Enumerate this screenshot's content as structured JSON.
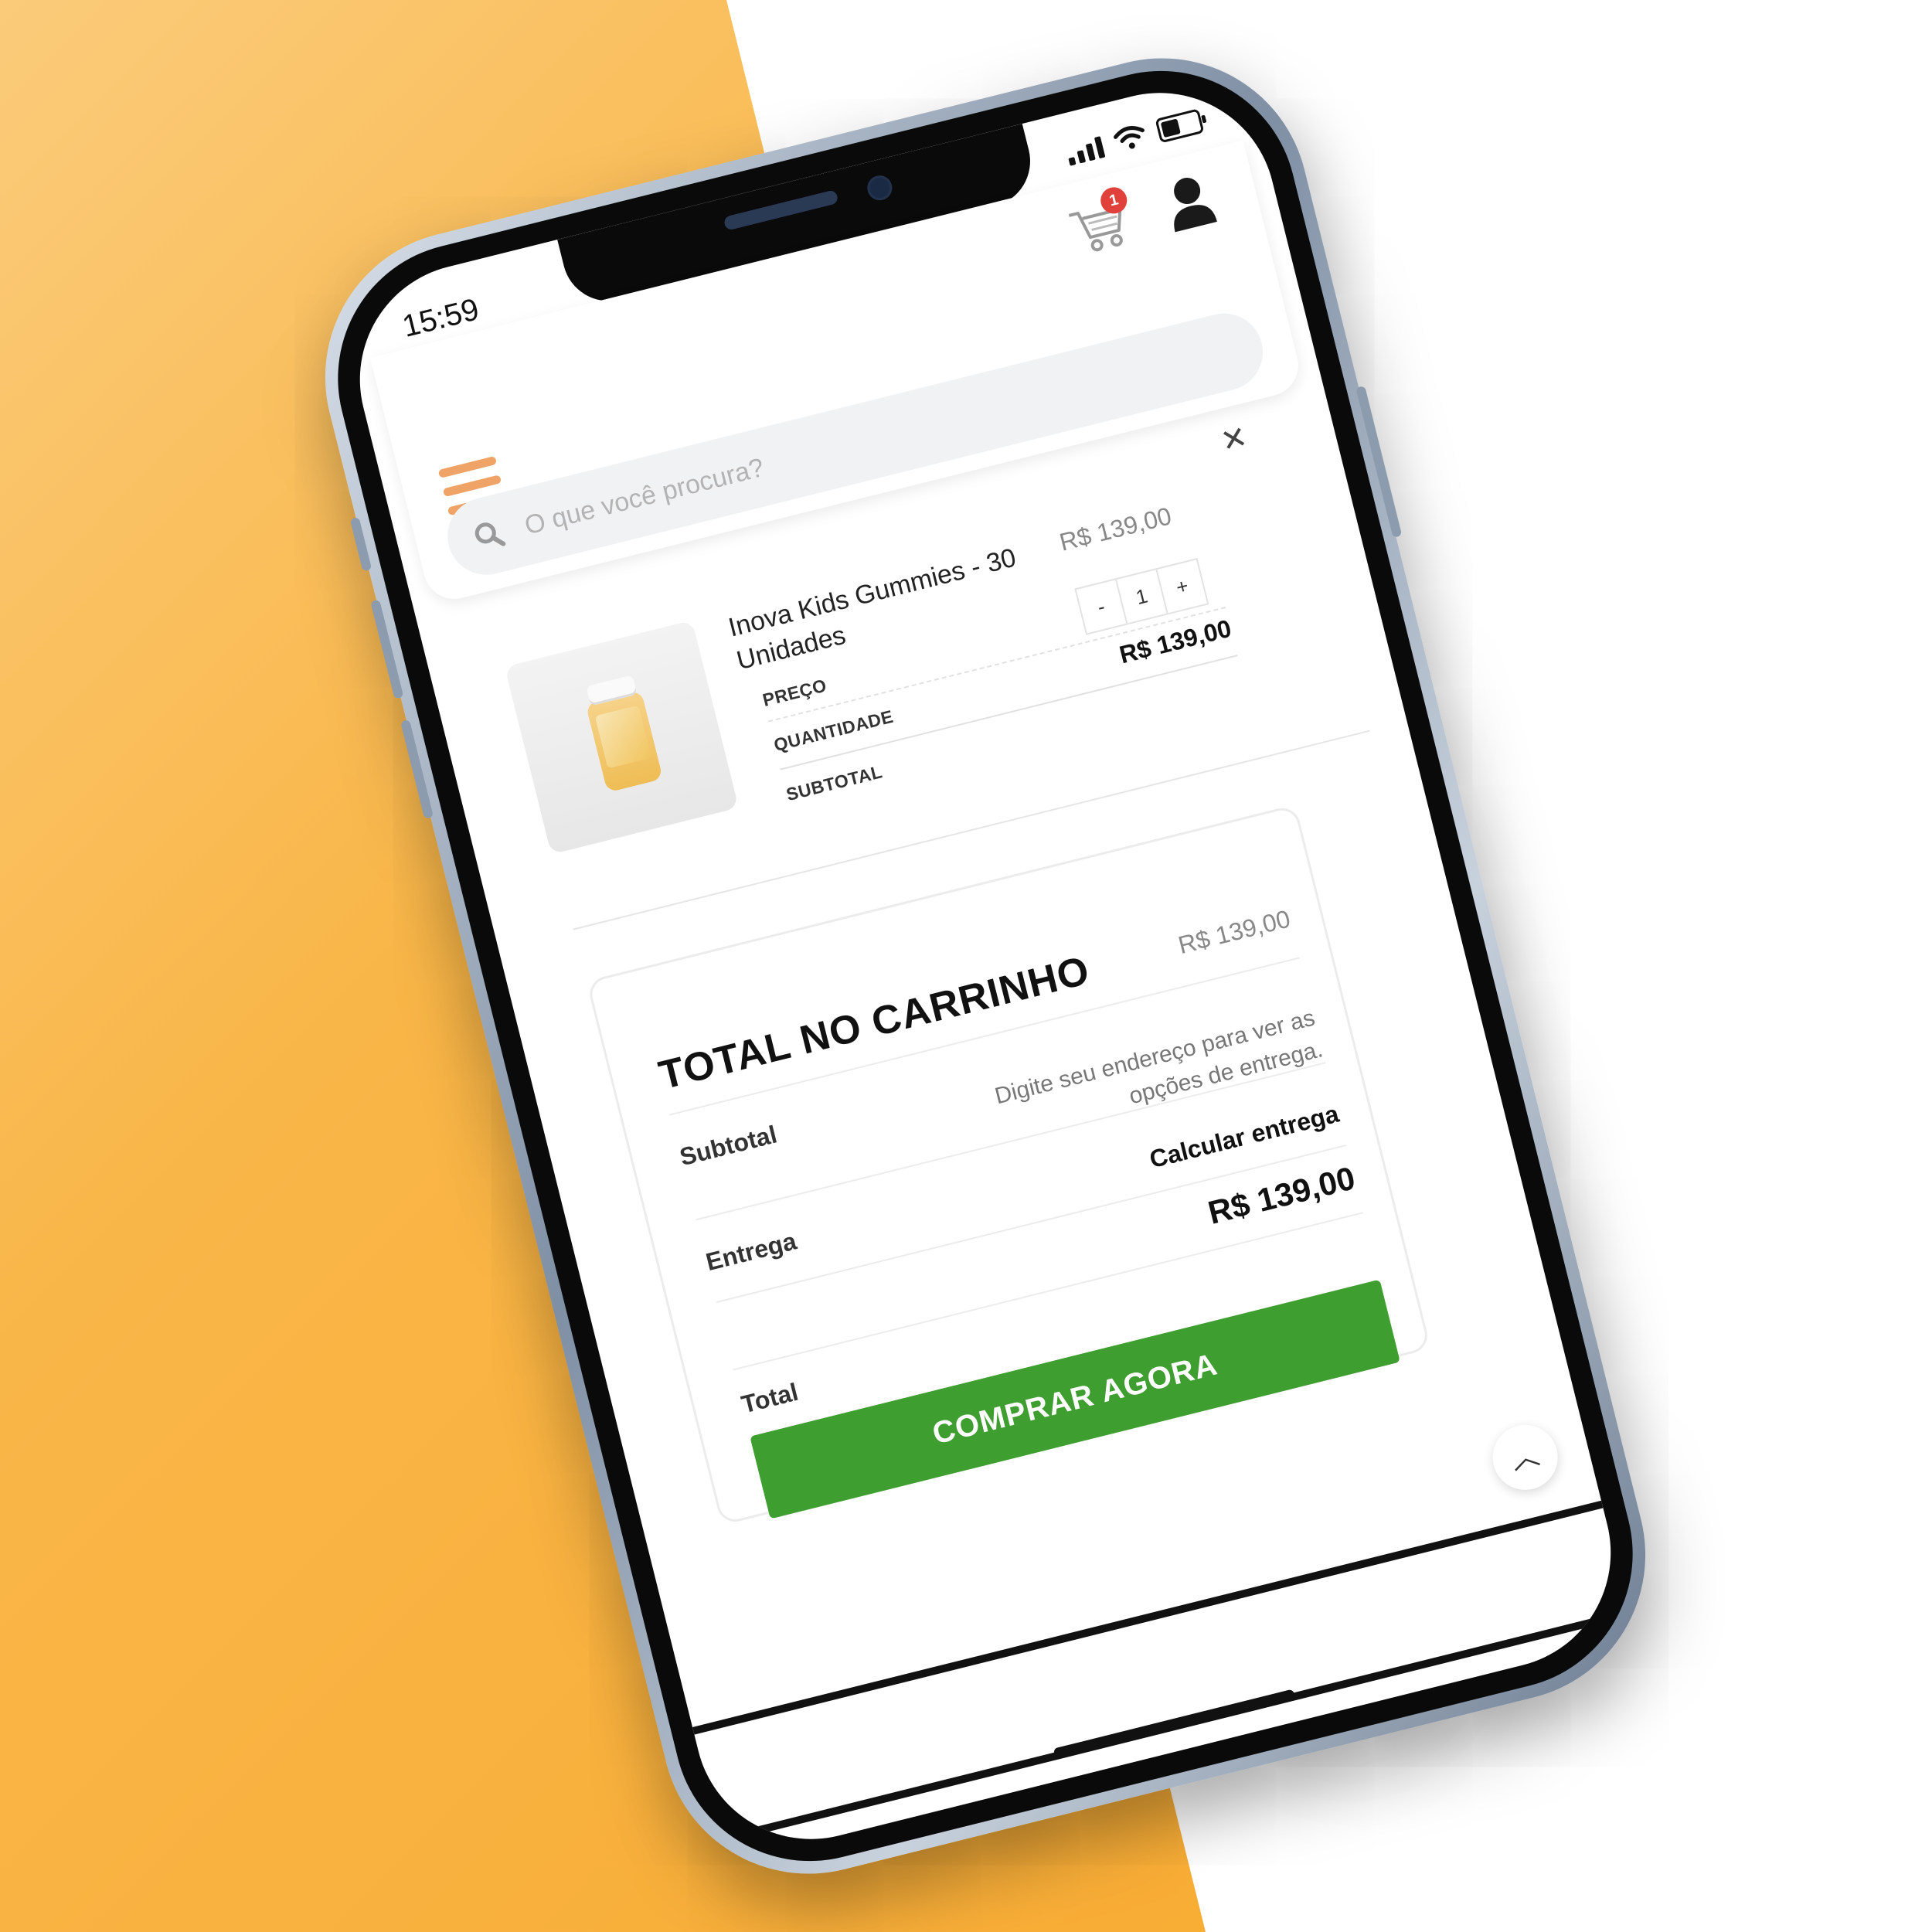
{
  "status_bar": {
    "time": "15:59"
  },
  "header": {
    "cart_count": "1",
    "search_placeholder": "O que você procura?"
  },
  "cart_item": {
    "name": "Inova Kids Gummies - 30 Unidades",
    "price": "R$ 139,00",
    "quantity": "1",
    "minus_label": "-",
    "plus_label": "+",
    "subtotal": "R$ 139,00",
    "labels": {
      "price": "PREÇO",
      "quantity": "QUANTIDADE",
      "subtotal": "SUBTOTAL"
    }
  },
  "totals": {
    "title": "TOTAL NO CARRINHO",
    "subtotal_label": "Subtotal",
    "subtotal_value": "R$ 139,00",
    "shipping_label": "Entrega",
    "shipping_note": "Digite seu endereço para ver as opções de entrega.",
    "calculate_shipping": "Calcular entrega",
    "total_label": "Total",
    "total_value": "R$ 139,00",
    "buy_button": "COMPRAR AGORA"
  },
  "colors": {
    "accent_orange": "#f8a92d",
    "buy_green": "#3f9e30",
    "badge_red": "#e0413b",
    "menu_orange": "#f0a366"
  },
  "icons": [
    "cart-icon",
    "user-icon",
    "menu-icon",
    "search-icon",
    "close-icon",
    "chevron-up-icon"
  ]
}
